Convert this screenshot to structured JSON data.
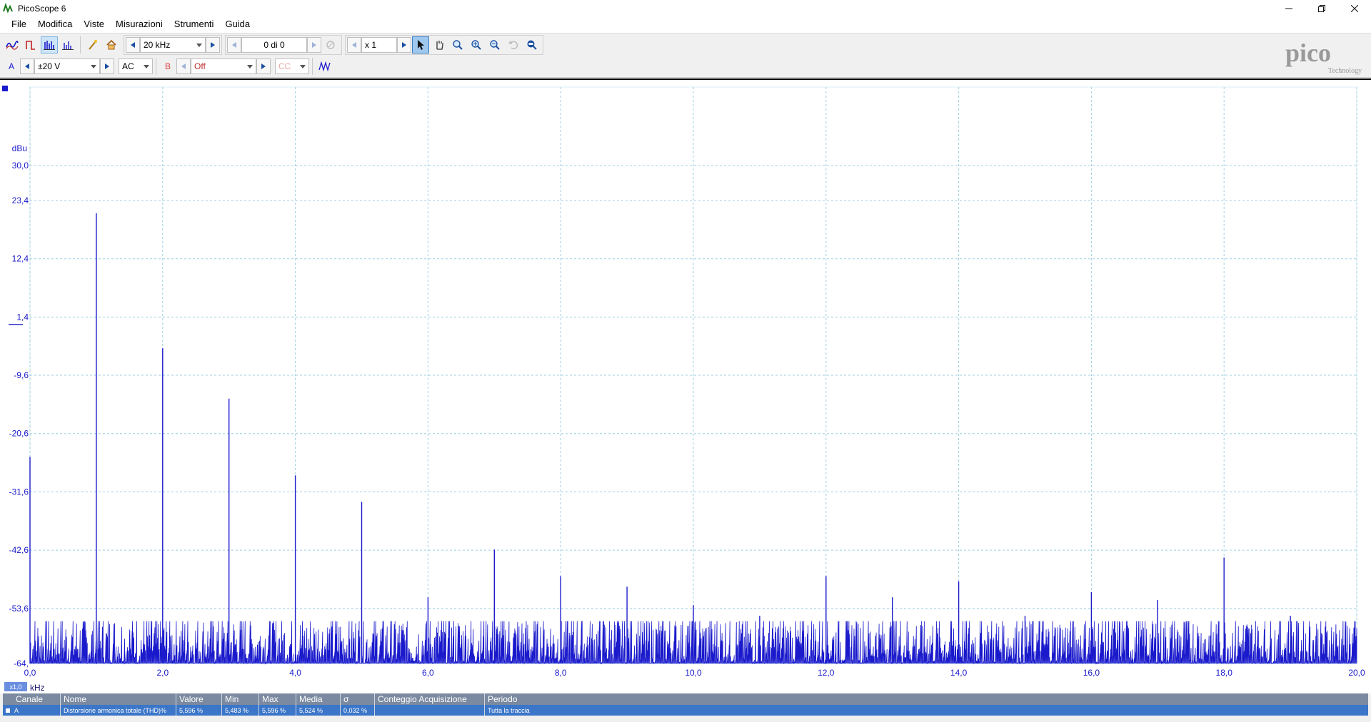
{
  "window": {
    "title": "PicoScope 6",
    "icon": "picoscope-app-icon",
    "buttons": [
      "minimize-icon",
      "restore-icon",
      "close-icon"
    ]
  },
  "menu": [
    {
      "label": "File"
    },
    {
      "label": "Modifica"
    },
    {
      "label": "Viste"
    },
    {
      "label": "Misurazioni"
    },
    {
      "label": "Strumenti"
    },
    {
      "label": "Guida"
    }
  ],
  "toolbar1": {
    "timebase": "20 kHz",
    "buffer": "0 di 0",
    "zoom": "x 1"
  },
  "toolbar2": {
    "channel_a": "A",
    "range_a": "±20 V",
    "coupling_a": "AC",
    "channel_b": "B",
    "range_b": "Off",
    "coupling_b": "CC"
  },
  "logo": {
    "text": "pico",
    "subtext": "Technology"
  },
  "colors": {
    "trace": "#1a1acc",
    "grid": "#9ccfe0",
    "axis_text": "#1a1acc",
    "channel_b": "#e04040"
  },
  "chart_data": {
    "type": "line",
    "title": "",
    "xlabel": "kHz",
    "ylabel": "dBu",
    "x_scale_label": "x1,0",
    "xlim": [
      0.0,
      20.0
    ],
    "ylim": [
      -64.0,
      30.0
    ],
    "x_ticks": [
      "0,0",
      "2,0",
      "4,0",
      "6,0",
      "8,0",
      "10,0",
      "12,0",
      "14,0",
      "16,0",
      "18,0",
      "20,0"
    ],
    "y_ticks": [
      {
        "label": "30,0",
        "value": 30.0
      },
      {
        "label": "23,4",
        "value": 23.4
      },
      {
        "label": "12,4",
        "value": 12.4
      },
      {
        "label": "1,4",
        "value": 1.4
      },
      {
        "label": "-9,6",
        "value": -9.6
      },
      {
        "label": "-20,6",
        "value": -20.6
      },
      {
        "label": "-31,6",
        "value": -31.6
      },
      {
        "label": "-42,6",
        "value": -42.6
      },
      {
        "label": "-53,6",
        "value": -53.6
      },
      {
        "label": "-64,",
        "value": -64.0
      }
    ],
    "grid": true,
    "noise_floor_dbu": [
      -64.0,
      -56.0
    ],
    "peaks": [
      {
        "x": 0.0,
        "y": -25.0
      },
      {
        "x": 1.0,
        "y": 21.0
      },
      {
        "x": 2.0,
        "y": -4.5
      },
      {
        "x": 3.0,
        "y": -14.0
      },
      {
        "x": 4.0,
        "y": -28.5
      },
      {
        "x": 5.0,
        "y": -33.5
      },
      {
        "x": 6.0,
        "y": -51.5
      },
      {
        "x": 7.0,
        "y": -42.5
      },
      {
        "x": 8.0,
        "y": -47.5
      },
      {
        "x": 9.0,
        "y": -49.5
      },
      {
        "x": 10.0,
        "y": -53.0
      },
      {
        "x": 11.0,
        "y": -55.0
      },
      {
        "x": 12.0,
        "y": -47.5
      },
      {
        "x": 13.0,
        "y": -51.5
      },
      {
        "x": 14.0,
        "y": -48.5
      },
      {
        "x": 15.0,
        "y": -55.0
      },
      {
        "x": 16.0,
        "y": -50.5
      },
      {
        "x": 17.0,
        "y": -52.0
      },
      {
        "x": 18.0,
        "y": -44.0
      },
      {
        "x": 19.0,
        "y": -55.0
      }
    ]
  },
  "measurements": {
    "headers": [
      "Canale",
      "Nome",
      "Valore",
      "Min",
      "Max",
      "Media",
      "σ",
      "Conteggio Acquisizione",
      "Periodo"
    ],
    "rows": [
      {
        "channel": "A",
        "name": "Distorsione armonica totale (THD)%",
        "value": "5,596 %",
        "min": "5,483 %",
        "max": "5,596 %",
        "mean": "5,524 %",
        "sigma": "0,032 %",
        "count": "",
        "period": "Tutta la traccia"
      }
    ]
  }
}
